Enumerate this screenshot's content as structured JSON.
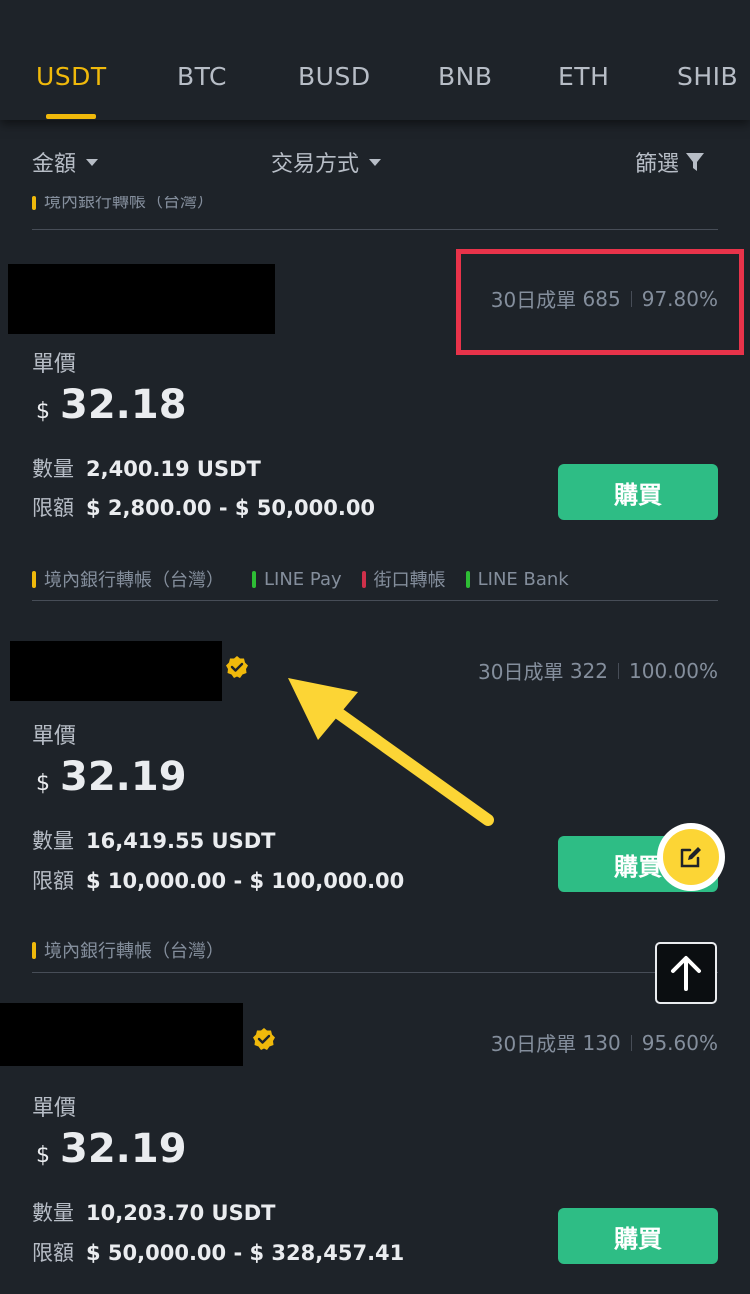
{
  "tabs": [
    {
      "label": "USDT",
      "active": true
    },
    {
      "label": "BTC",
      "active": false
    },
    {
      "label": "BUSD",
      "active": false
    },
    {
      "label": "BNB",
      "active": false
    },
    {
      "label": "ETH",
      "active": false
    },
    {
      "label": "SHIB",
      "active": false
    }
  ],
  "filters": {
    "amount": "金額",
    "payment": "交易方式",
    "filter": "篩選"
  },
  "cut_tag": "境內銀行轉帳（台灣）",
  "listings": [
    {
      "orders_label": "30日成單",
      "orders": "685",
      "completion": "97.80%",
      "price_label": "單價",
      "currency": "$",
      "price": "32.18",
      "qty_label": "數量",
      "qty": "2,400.19 USDT",
      "limit_label": "限額",
      "limit": "$ 2,800.00 -  $ 50,000.00",
      "buy": "購買",
      "tags": [
        {
          "label": "境內銀行轉帳（台灣）",
          "color": "#f0b90b"
        },
        {
          "label": "LINE Pay",
          "color": "#2ebd35"
        },
        {
          "label": "街口轉帳",
          "color": "#cf304a"
        },
        {
          "label": "LINE Bank",
          "color": "#2ebd35"
        }
      ]
    },
    {
      "orders_label": "30日成單",
      "orders": "322",
      "completion": "100.00%",
      "price_label": "單價",
      "currency": "$",
      "price": "32.19",
      "qty_label": "數量",
      "qty": "16,419.55 USDT",
      "limit_label": "限額",
      "limit": "$ 10,000.00 -  $ 100,000.00",
      "buy": "購買",
      "tags": [
        {
          "label": "境內銀行轉帳（台灣）",
          "color": "#f0b90b"
        }
      ]
    },
    {
      "orders_label": "30日成單",
      "orders": "130",
      "completion": "95.60%",
      "price_label": "單價",
      "currency": "$",
      "price": "32.19",
      "qty_label": "數量",
      "qty": "10,203.70 USDT",
      "limit_label": "限額",
      "limit": "$ 50,000.00 -  $ 328,457.41",
      "buy": "購買"
    }
  ],
  "colors": {
    "accent": "#f0b90b",
    "buy": "#2ebd85",
    "highlight": "#e8334a",
    "verified": "#f0b90b"
  }
}
